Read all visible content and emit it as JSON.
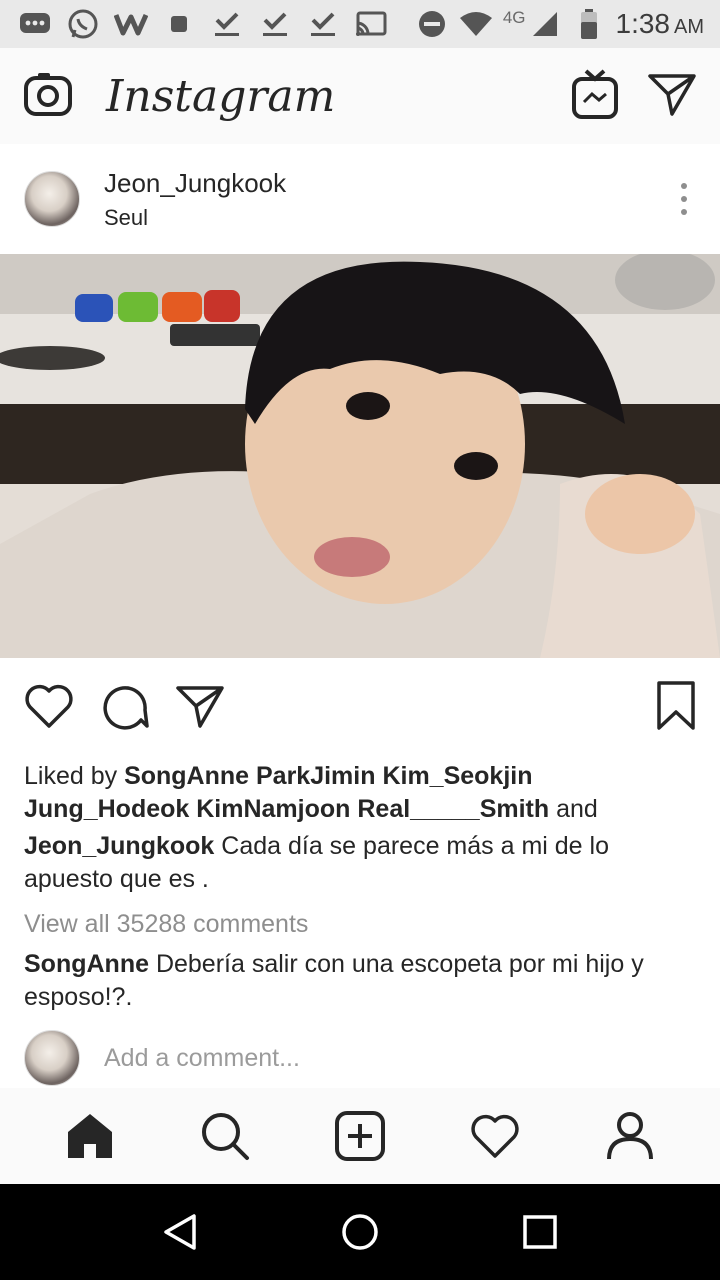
{
  "status_bar": {
    "time": "1:38",
    "ampm": "AM",
    "network": "4G",
    "icons": [
      "messages-icon",
      "whatsapp-icon",
      "w-app-icon",
      "square-icon",
      "check-icon",
      "check-icon",
      "check-icon",
      "cast-icon",
      "do-not-disturb-icon",
      "wifi-icon",
      "signal-icon",
      "battery-icon"
    ]
  },
  "header": {
    "logo": "Instagram",
    "icons": [
      "camera-icon",
      "igtv-icon",
      "direct-icon"
    ]
  },
  "post": {
    "username": "Jeon_Jungkook",
    "location": "Seul",
    "liked_by_prefix": "Liked by ",
    "liked_by_names": "SongAnne ParkJimin Kim_Seokjin Jung_Hodeok KimNamjoon Real_____Smith",
    "liked_by_suffix": " and",
    "caption_user": "Jeon_Jungkook",
    "caption_text": " Cada día se parece más a mi de lo apuesto que es .",
    "view_all_comments": "View all 35288 comments",
    "comment_user": "SongAnne",
    "comment_text": " Debería salir con una escopeta por mi hijo y esposo!?.",
    "add_comment_placeholder": "Add a comment..."
  },
  "bottom_nav": {
    "items": [
      "home-icon",
      "search-icon",
      "new-post-icon",
      "activity-icon",
      "profile-icon"
    ]
  },
  "system_nav": {
    "items": [
      "back-icon",
      "home-circle-icon",
      "recents-icon"
    ]
  }
}
